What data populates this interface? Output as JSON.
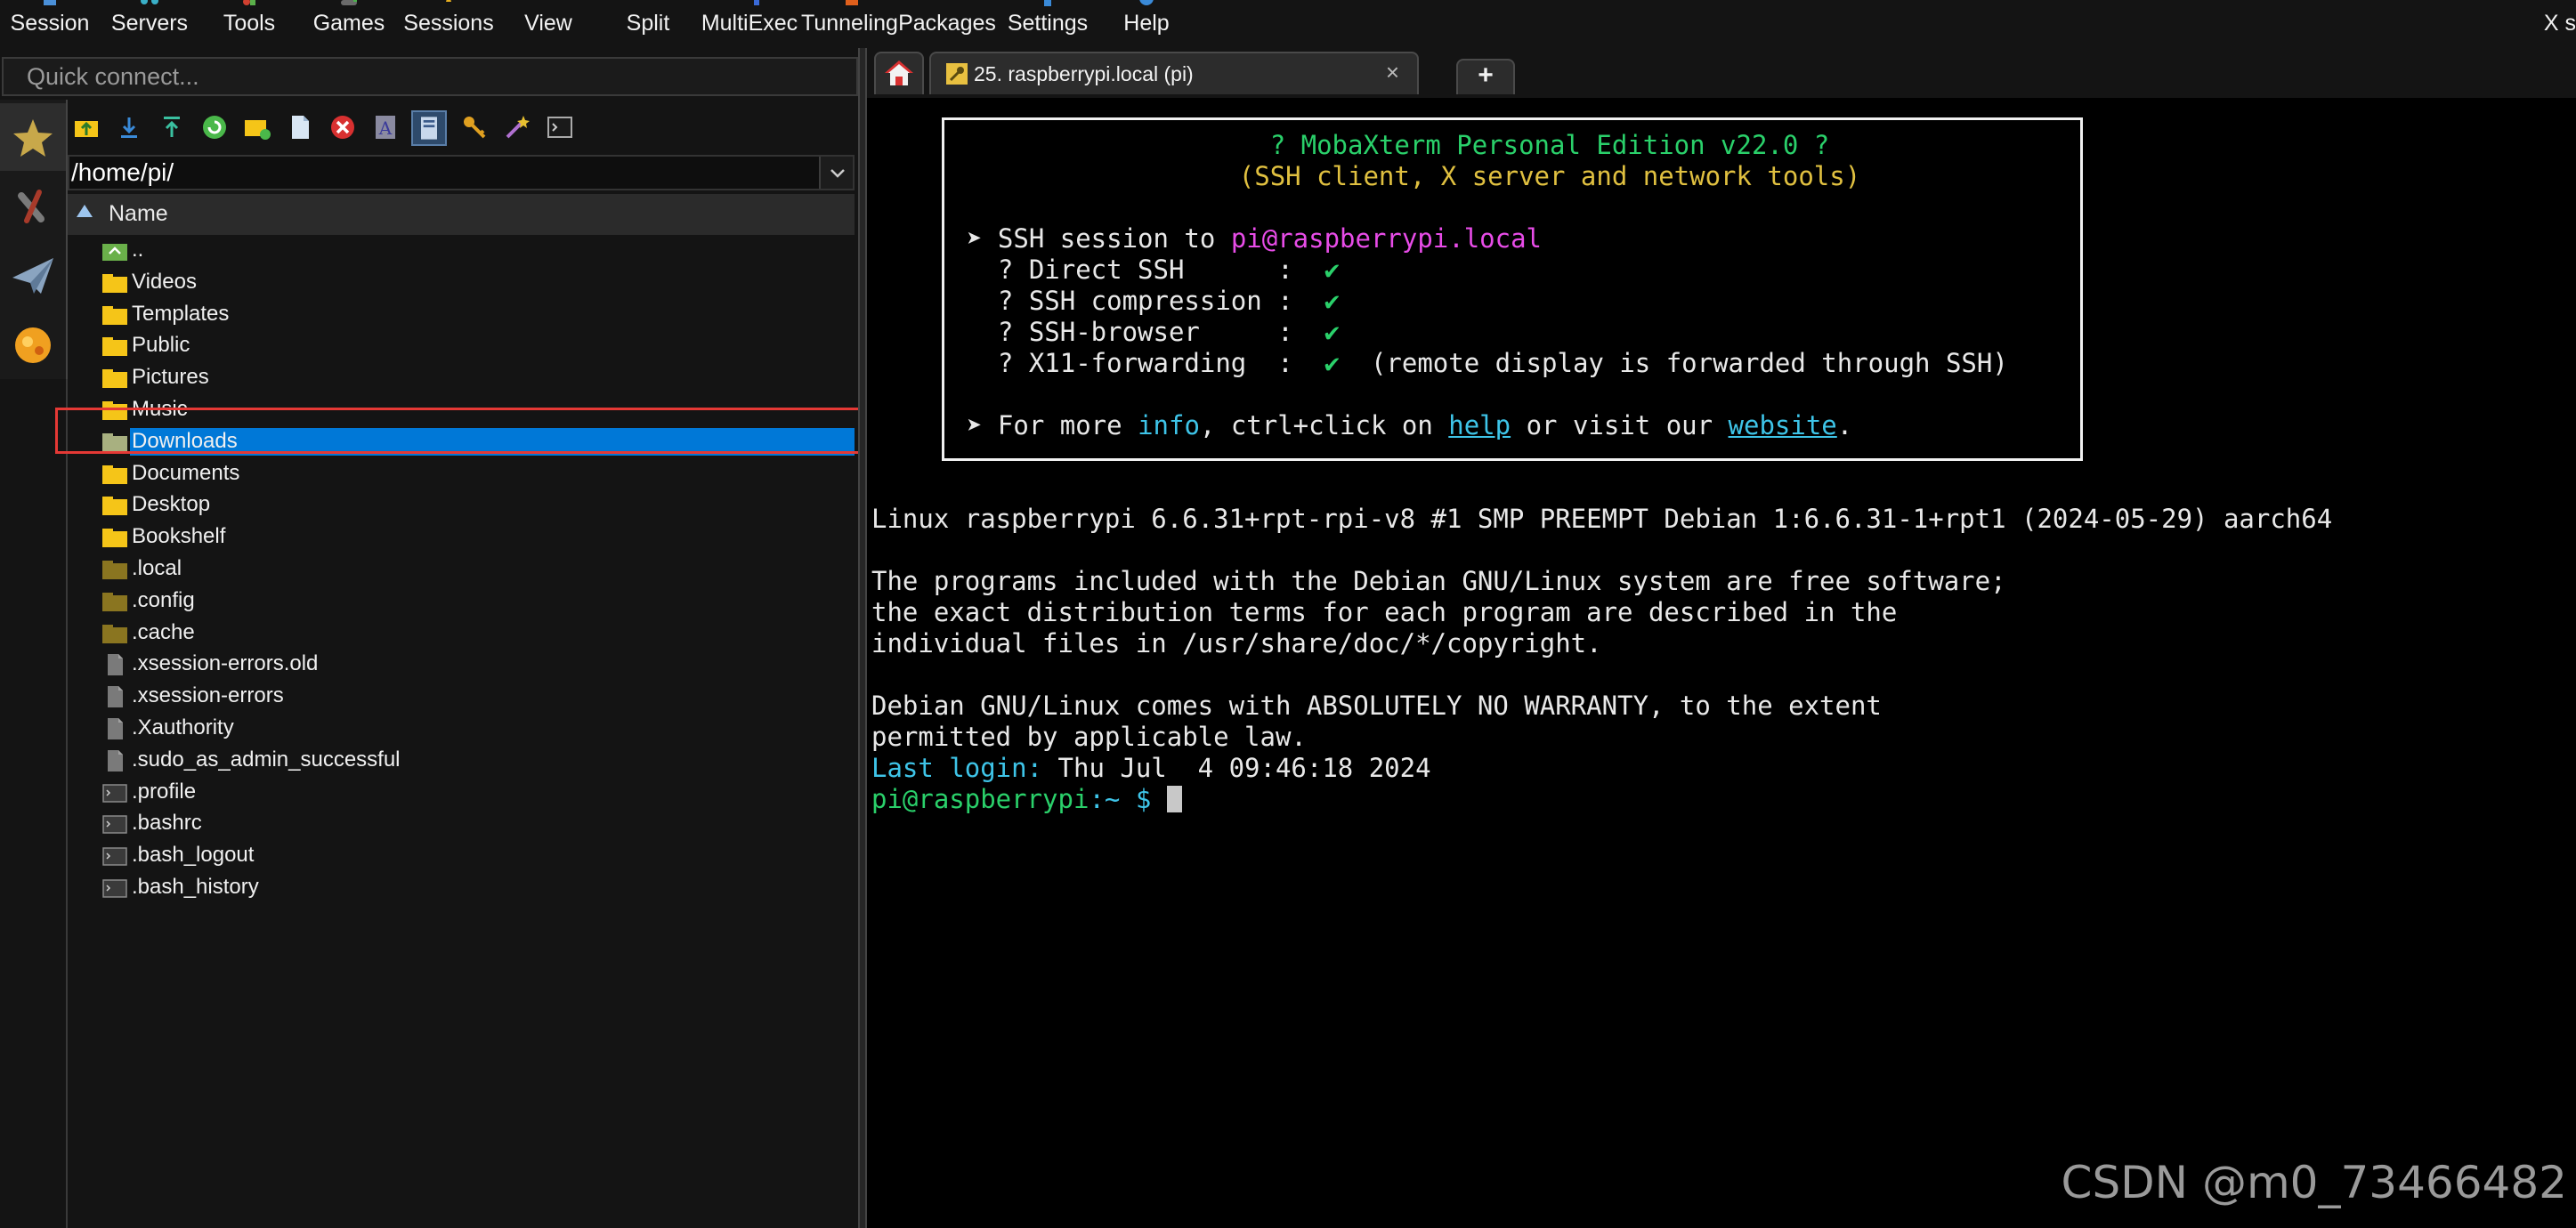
{
  "menubar": {
    "items": [
      {
        "label": "Session",
        "icon": "session-icon"
      },
      {
        "label": "Servers",
        "icon": "servers-icon"
      },
      {
        "label": "Tools",
        "icon": "tools-icon"
      },
      {
        "label": "Games",
        "icon": "games-icon"
      },
      {
        "label": "Sessions",
        "icon": "sessions-icon"
      },
      {
        "label": "View",
        "icon": "view-icon"
      },
      {
        "label": "Split",
        "icon": "split-icon"
      },
      {
        "label": "MultiExec",
        "icon": "multiexec-icon"
      },
      {
        "label": "Tunneling",
        "icon": "tunneling-icon"
      },
      {
        "label": "Packages",
        "icon": "packages-icon"
      },
      {
        "label": "Settings",
        "icon": "settings-icon"
      },
      {
        "label": "Help",
        "icon": "help-icon"
      }
    ],
    "xserver_label": "X s"
  },
  "quick_connect": {
    "placeholder": "Quick connect..."
  },
  "side_tabs": [
    "star-icon",
    "tools-icon",
    "paper-plane-icon",
    "globe-icon"
  ],
  "file_browser": {
    "toolbar_icons": [
      "folder-up-icon",
      "download-icon",
      "upload-icon",
      "refresh-icon",
      "new-folder-icon",
      "new-file-icon",
      "delete-icon",
      "rename-icon",
      "follow-terminal-icon",
      "key-icon",
      "magic-icon",
      "terminal-icon"
    ],
    "path": "/home/pi/",
    "column_header": "Name",
    "files": [
      {
        "name": "..",
        "type": "parent"
      },
      {
        "name": "Videos",
        "type": "folder"
      },
      {
        "name": "Templates",
        "type": "folder"
      },
      {
        "name": "Public",
        "type": "folder"
      },
      {
        "name": "Pictures",
        "type": "folder"
      },
      {
        "name": "Music",
        "type": "folder"
      },
      {
        "name": "Downloads",
        "type": "folder",
        "selected": true
      },
      {
        "name": "Documents",
        "type": "folder"
      },
      {
        "name": "Desktop",
        "type": "folder"
      },
      {
        "name": "Bookshelf",
        "type": "folder"
      },
      {
        "name": ".local",
        "type": "hidden-folder"
      },
      {
        "name": ".config",
        "type": "hidden-folder"
      },
      {
        "name": ".cache",
        "type": "hidden-folder"
      },
      {
        "name": ".xsession-errors.old",
        "type": "file"
      },
      {
        "name": ".xsession-errors",
        "type": "file"
      },
      {
        "name": ".Xauthority",
        "type": "file"
      },
      {
        "name": ".sudo_as_admin_successful",
        "type": "file"
      },
      {
        "name": ".profile",
        "type": "script"
      },
      {
        "name": ".bashrc",
        "type": "script"
      },
      {
        "name": ".bash_logout",
        "type": "script"
      },
      {
        "name": ".bash_history",
        "type": "script"
      }
    ]
  },
  "tabs": {
    "home_icon": "home-icon",
    "session_tab": {
      "label": "25. raspberrypi.local (pi)",
      "close": "×"
    },
    "new_tab": "+"
  },
  "terminal": {
    "banner_title": "? MobaXterm Personal Edition v22.0 ?",
    "banner_subtitle": "(SSH client, X server and network tools)",
    "ssh_prefix": "➤ SSH session to ",
    "ssh_target": "pi@raspberrypi.local",
    "features": [
      {
        "label": "  ? Direct SSH      :  ",
        "mark": "✔",
        "note": ""
      },
      {
        "label": "  ? SSH compression :  ",
        "mark": "✔",
        "note": ""
      },
      {
        "label": "  ? SSH-browser     :  ",
        "mark": "✔",
        "note": ""
      },
      {
        "label": "  ? X11-forwarding  :  ",
        "mark": "✔",
        "note": "  (remote display is forwarded through SSH)"
      }
    ],
    "more_info": {
      "p1": "➤ For more ",
      "info": "info",
      "p2": ", ctrl+click on ",
      "help": "help",
      "p3": " or visit our ",
      "website": "website",
      "p4": "."
    },
    "uname": "Linux raspberrypi 6.6.31+rpt-rpi-v8 #1 SMP PREEMPT Debian 1:6.6.31-1+rpt1 (2024-05-29) aarch64",
    "motd": [
      "The programs included with the Debian GNU/Linux system are free software;",
      "the exact distribution terms for each program are described in the",
      "individual files in /usr/share/doc/*/copyright."
    ],
    "warranty": [
      "Debian GNU/Linux comes with ABSOLUTELY NO WARRANTY, to the extent",
      "permitted by applicable law."
    ],
    "last_login_label": "Last login:",
    "last_login_value": " Thu Jul  4 09:46:18 2024",
    "prompt_user": "pi@raspberrypi",
    "prompt_path": ":~ $ "
  },
  "watermark": "CSDN @m0_73466482",
  "colors": {
    "selection": "#0078d7",
    "highlight_box": "#e53935",
    "term_green": "#2ad06a",
    "term_yellow": "#e0c040",
    "term_magenta": "#e84ce8",
    "term_cyan": "#3ec4e8",
    "folder": "#f5c518"
  }
}
